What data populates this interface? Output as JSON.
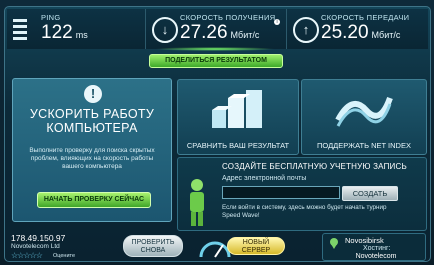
{
  "metrics": {
    "ping": {
      "label": "PING",
      "value": "122",
      "unit": "ms"
    },
    "download": {
      "label": "СКОРОСТЬ ПОЛУЧЕНИЯ",
      "value": "27.26",
      "unit": "Мбит/с"
    },
    "upload": {
      "label": "СКОРОСТЬ ПЕРЕДАЧИ",
      "value": "25.20",
      "unit": "Мбит/с"
    }
  },
  "share_button": "ПОДЕЛИТЬСЯ РЕЗУЛЬТАТОМ",
  "left_panel": {
    "title": "УСКОРИТЬ РАБОТУ КОМПЬЮТЕРА",
    "description": "Выполните проверку для поиска скрытых проблем, влияющих на скорость работы вашего компьютера",
    "button": "НАЧАТЬ ПРОВЕРКУ СЕЙЧАС"
  },
  "tiles": {
    "compare": "СРАВНИТЬ ВАШ РЕЗУЛЬТАТ",
    "netindex": "ПОДДЕРЖАТЬ NET INDEX"
  },
  "signup": {
    "title": "СОЗДАЙТЕ БЕСПЛАТНУЮ УЧЕТНУЮ ЗАПИСЬ",
    "email_label": "Адрес электронной почты",
    "email_value": "",
    "create_button": "СОЗДАТЬ",
    "note": "Если войти в систему, здесь можно будет начать турнир Speed Wave!"
  },
  "bottom": {
    "ip": "178.49.150.97",
    "isp": "Novotelecom Ltd",
    "rate_label": "Оцените",
    "test_again": "ПРОВЕРИТЬ СНОВА",
    "new_server": "НОВЫЙ СЕРВЕР",
    "server_city": "Novosibirsk",
    "host_label": "Хостинг:",
    "host": "Novotelecom"
  },
  "colors": {
    "accent_green": "#3da92a",
    "panel_blue": "#2c7188",
    "background": "#0c2a39"
  }
}
